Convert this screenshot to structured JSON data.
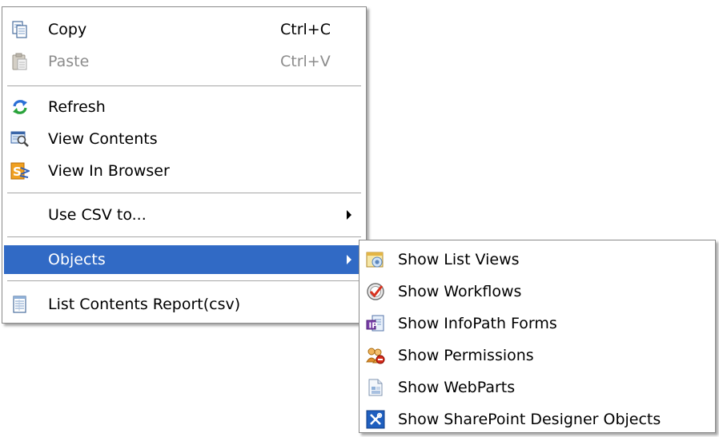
{
  "colors": {
    "highlight_bg": "#316ac5",
    "highlight_fg": "#ffffff",
    "disabled_fg": "#8c8c8c",
    "border": "#8a8a8a",
    "separator": "#a6a6a6"
  },
  "context_menu": {
    "items": [
      {
        "label": "Copy",
        "shortcut": "Ctrl+C",
        "icon": "copy-icon",
        "enabled": true
      },
      {
        "label": "Paste",
        "shortcut": "Ctrl+V",
        "icon": "paste-icon",
        "enabled": false
      },
      {
        "label": "Refresh",
        "icon": "refresh-icon",
        "enabled": true
      },
      {
        "label": "View Contents",
        "icon": "view-contents-icon",
        "enabled": true
      },
      {
        "label": "View In Browser",
        "icon": "sharepoint-icon",
        "enabled": true
      },
      {
        "label": "Use CSV to...",
        "submenu": true,
        "enabled": true
      },
      {
        "label": "Objects",
        "submenu": true,
        "highlighted": true,
        "enabled": true
      },
      {
        "label": "List Contents Report(csv)",
        "icon": "report-icon",
        "enabled": true
      }
    ]
  },
  "objects_submenu": {
    "items": [
      {
        "label": "Show List Views",
        "icon": "list-views-icon"
      },
      {
        "label": "Show Workflows",
        "icon": "workflow-icon"
      },
      {
        "label": "Show InfoPath Forms",
        "icon": "infopath-icon"
      },
      {
        "label": "Show Permissions",
        "icon": "permissions-icon"
      },
      {
        "label": "Show WebParts",
        "icon": "webparts-icon"
      },
      {
        "label": "Show SharePoint Designer Objects",
        "icon": "designer-tools-icon"
      }
    ]
  }
}
